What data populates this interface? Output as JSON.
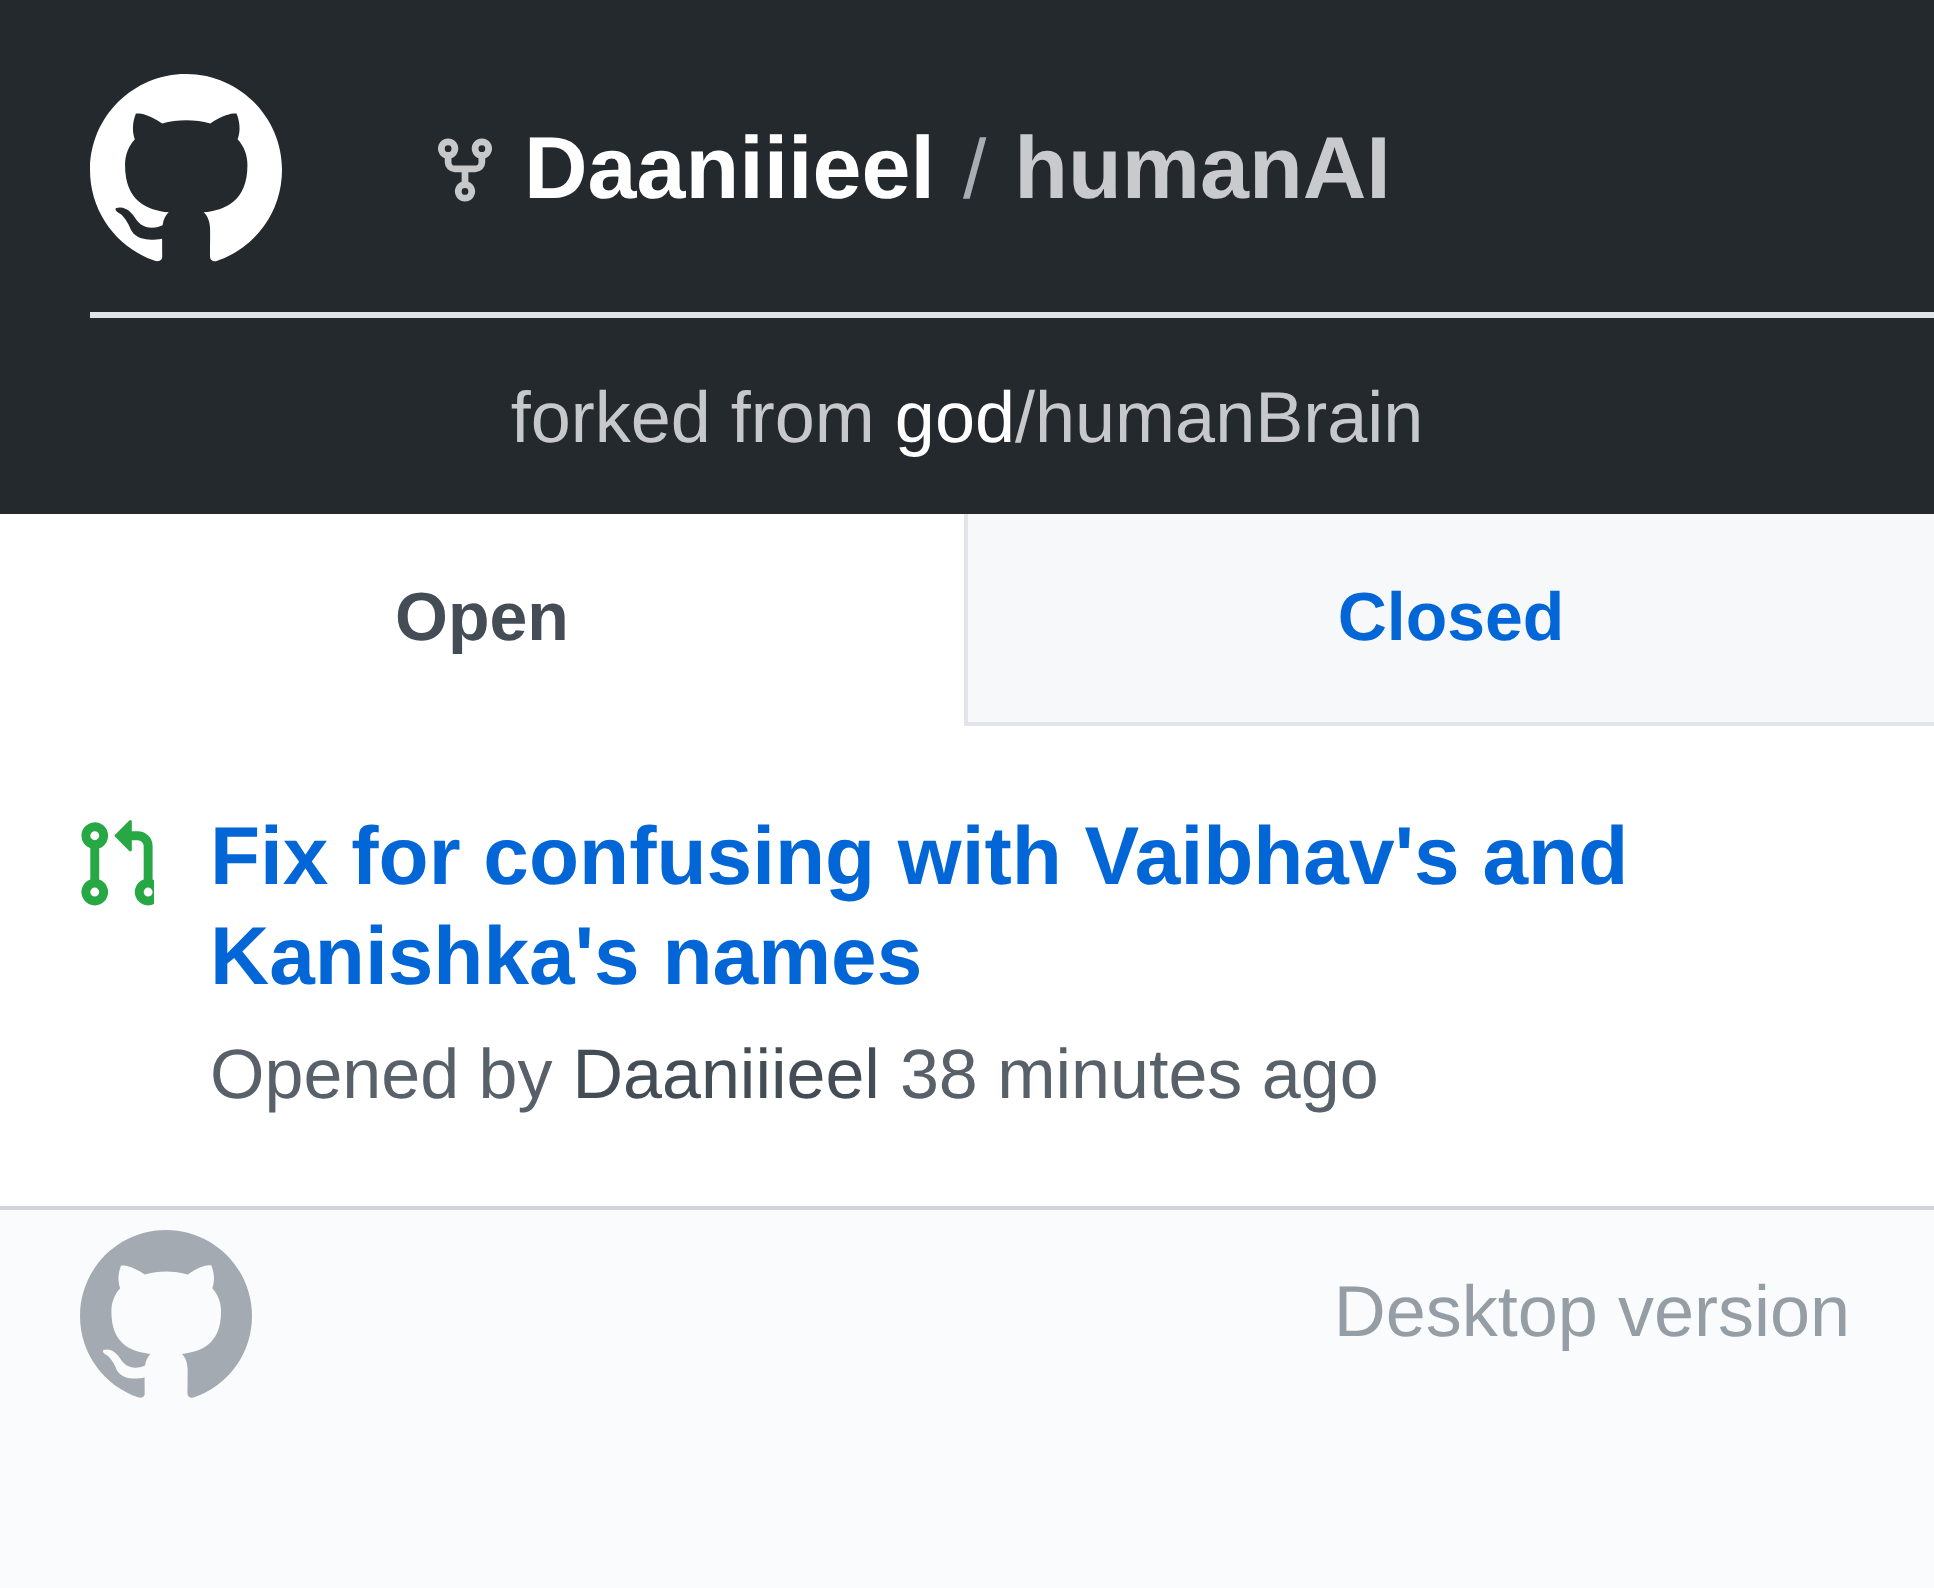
{
  "header": {
    "repo": {
      "owner": "Daaniiieel",
      "separator": "/",
      "name": "humanAI"
    },
    "forked_from": {
      "label": "forked from",
      "owner": "god",
      "separator": "/",
      "repo": "humanBrain"
    }
  },
  "tabs": [
    {
      "label": "Open",
      "selected": true
    },
    {
      "label": "Closed",
      "selected": false
    }
  ],
  "pull_requests": [
    {
      "title": "Fix for confusing with Vaibhav's and Kanishka's names",
      "meta": {
        "prefix": "Opened by",
        "author": "Daaniiieel",
        "time": "38 minutes ago"
      }
    }
  ],
  "footer": {
    "link": "Desktop version"
  }
}
